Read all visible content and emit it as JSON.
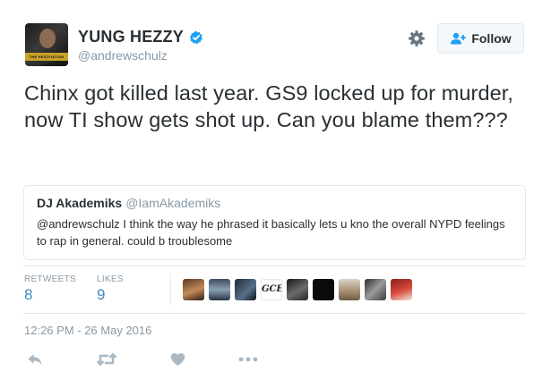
{
  "author": {
    "name": "YUNG HEZZY",
    "handle": "@andrewschulz",
    "avatar_caption": "THE HEZZYIATION TOUR"
  },
  "actions_header": {
    "follow_label": "Follow"
  },
  "tweet": {
    "text": "Chinx got killed last year. GS9 locked up for murder, now TI show gets shot up. Can you blame them???"
  },
  "quoted_tweet": {
    "name": "DJ Akademiks",
    "handle": "@IamAkademiks",
    "text": "@andrewschulz I think the way he phrased it basically lets u kno the overall NYPD feelings to rap in general.  could b troublesome"
  },
  "stats": {
    "retweets_label": "RETWEETS",
    "retweets": "8",
    "likes_label": "LIKES",
    "likes": "9"
  },
  "timestamp": "12:26 PM - 26 May 2016",
  "colors": {
    "accent": "#3b88c3",
    "verified": "#1da1f2",
    "muted": "#8899a6",
    "text": "#292f33"
  },
  "icons": [
    "verified-icon",
    "gear-icon",
    "follow-user-icon",
    "reply-icon",
    "retweet-icon",
    "like-icon",
    "more-icon"
  ]
}
